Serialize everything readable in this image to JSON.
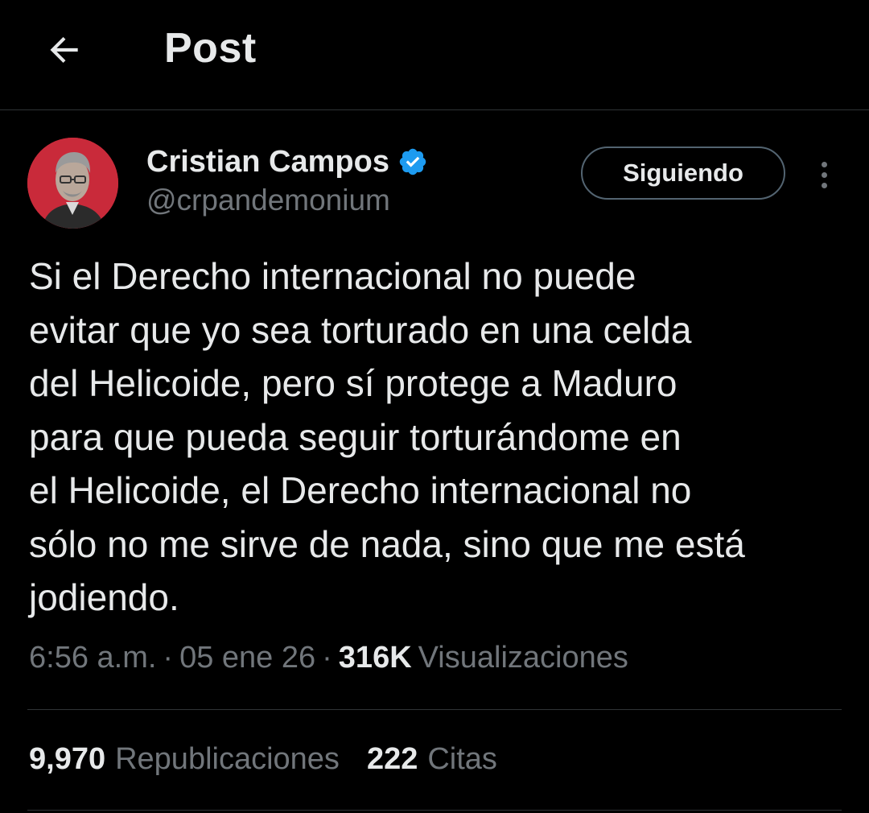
{
  "header": {
    "title": "Post",
    "back_icon": "arrow-left-icon"
  },
  "author": {
    "display_name": "Cristian Campos",
    "handle": "@crpandemonium",
    "verified": true,
    "verified_color": "#1d9bf0",
    "avatar_bg": "#c92a3a"
  },
  "actions": {
    "follow_label": "Siguiendo",
    "more_icon": "more-vertical-icon"
  },
  "tweet": {
    "lines": [
      "Si el Derecho internacional no puede",
      "evitar que yo sea torturado en una celda",
      "del Helicoide, pero sí protege a Maduro",
      "para que pueda seguir torturándome en",
      "el Helicoide, el Derecho internacional no",
      "sólo no me sirve de nada, sino que me está",
      "jodiendo."
    ]
  },
  "meta": {
    "time": "6:56 a.m.",
    "date": "05 ene 26",
    "separator": "·",
    "views_count": "316K",
    "views_label": "Visualizaciones"
  },
  "stats": {
    "reposts_count": "9,970",
    "reposts_label": "Republicaciones",
    "quotes_count": "222",
    "quotes_label": "Citas"
  },
  "colors": {
    "background": "#000000",
    "text_primary": "#e7e9ea",
    "text_secondary": "#71767b",
    "border": "#2f3336"
  }
}
